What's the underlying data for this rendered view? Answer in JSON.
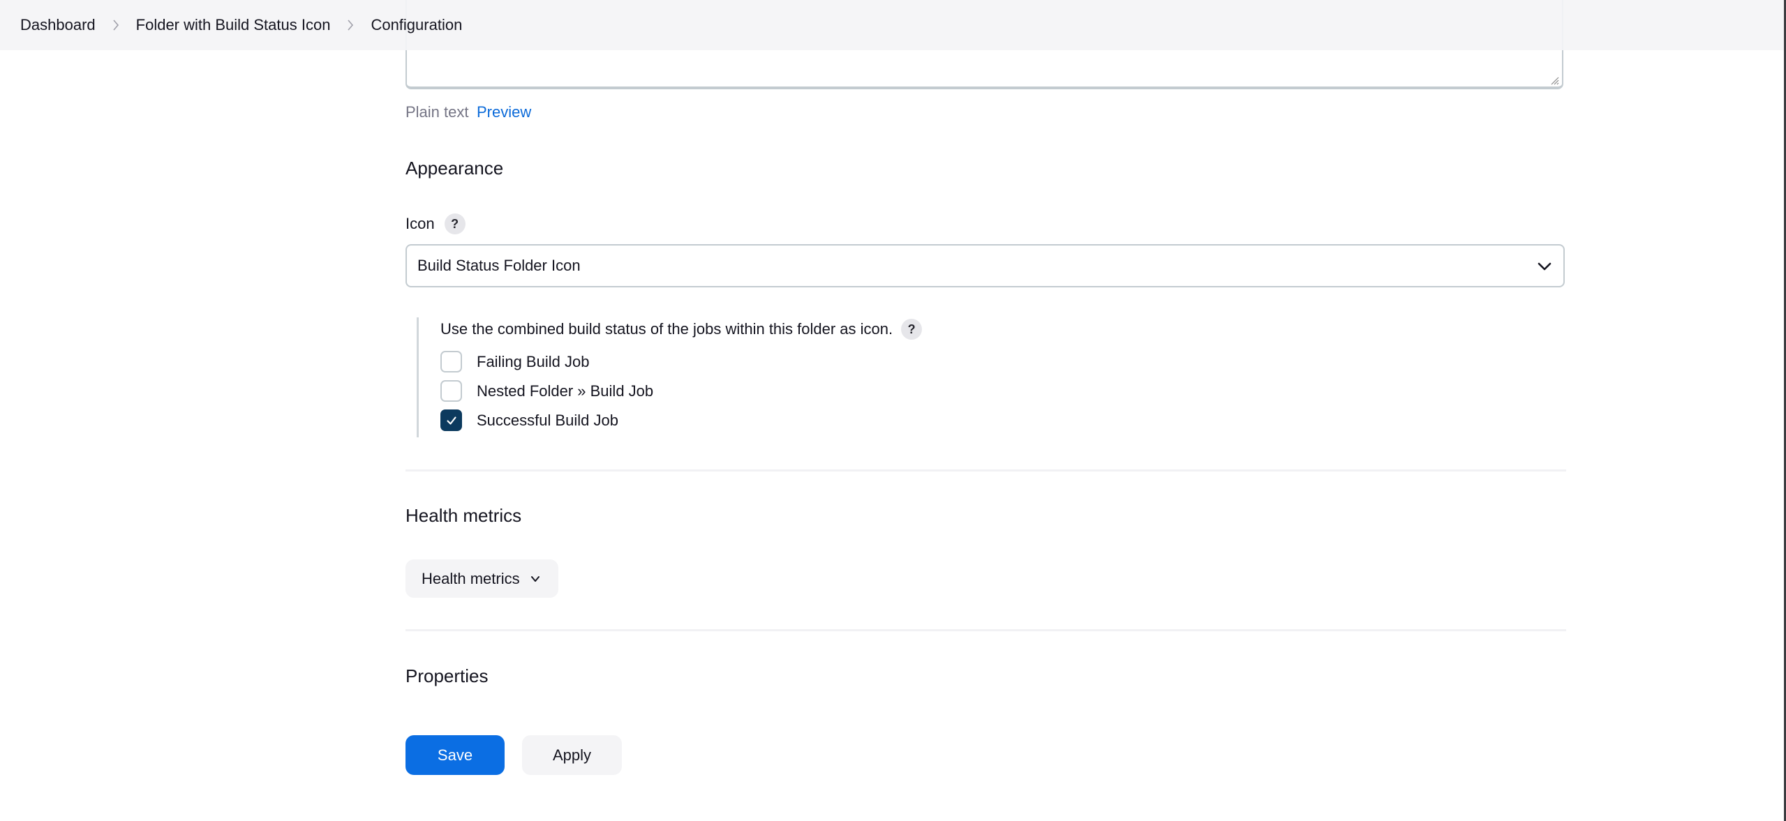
{
  "breadcrumb": {
    "items": [
      "Dashboard",
      "Folder with Build Status Icon",
      "Configuration"
    ]
  },
  "description_editor": {
    "value": "",
    "plain_text_label": "Plain text",
    "preview_label": "Preview"
  },
  "appearance": {
    "heading": "Appearance",
    "icon_label": "Icon",
    "help_glyph": "?",
    "icon_select": {
      "selected": "Build Status Folder Icon"
    },
    "build_status": {
      "description": "Use the combined build status of the jobs within this folder as icon.",
      "help_glyph": "?",
      "jobs": [
        {
          "label": "Failing Build Job",
          "checked": false
        },
        {
          "label": "Nested Folder » Build Job",
          "checked": false
        },
        {
          "label": "Successful Build Job",
          "checked": true
        }
      ]
    }
  },
  "health_metrics": {
    "heading": "Health metrics",
    "button_label": "Health metrics"
  },
  "properties": {
    "heading": "Properties"
  },
  "actions": {
    "save_label": "Save",
    "apply_label": "Apply"
  },
  "colors": {
    "primary": "#0b6ee3",
    "link": "#0b6ad9",
    "checkbox_checked": "#0c3a5e",
    "breadcrumb_bg": "#f4f4f6"
  }
}
